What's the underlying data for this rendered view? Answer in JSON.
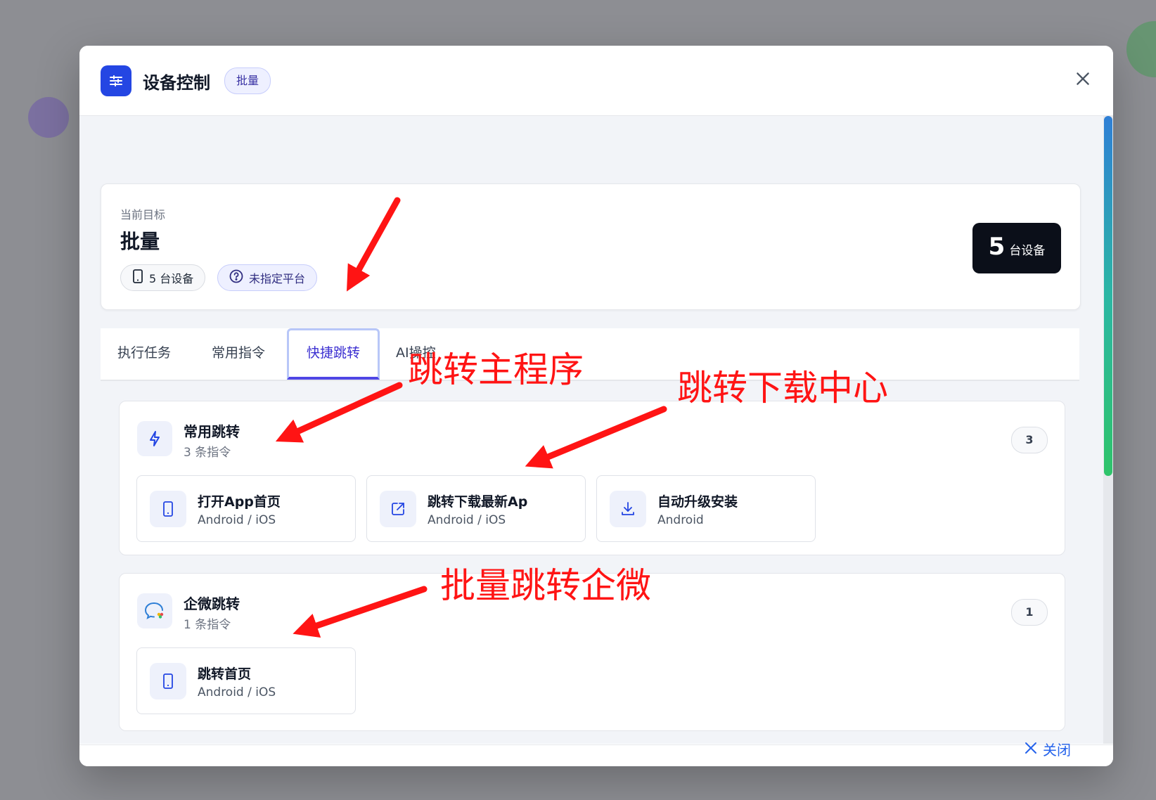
{
  "dialog": {
    "title": "设备控制",
    "badge": "批量",
    "icon": "sliders-icon"
  },
  "target": {
    "caption": "当前目标",
    "name": "批量",
    "devices_chip": "5 台设备",
    "platform_chip": "未指定平台",
    "count_number": "5",
    "count_unit": "台设备"
  },
  "tabs": [
    {
      "label": "执行任务",
      "active": false
    },
    {
      "label": "常用指令",
      "active": false
    },
    {
      "label": "快捷跳转",
      "active": true
    },
    {
      "label": "AI操控",
      "active": false
    }
  ],
  "groups": [
    {
      "title": "常用跳转",
      "subtitle": "3 条指令",
      "count": "3",
      "icon": "lightning-icon",
      "commands": [
        {
          "name": "打开App首页",
          "platforms": "Android / iOS",
          "icon": "phone-icon"
        },
        {
          "name": "跳转下载最新Ap",
          "platforms": "Android / iOS",
          "icon": "external-link-icon"
        },
        {
          "name": "自动升级安装",
          "platforms": "Android",
          "icon": "download-icon"
        }
      ]
    },
    {
      "title": "企微跳转",
      "subtitle": "1 条指令",
      "count": "1",
      "icon": "wecom-icon",
      "commands": [
        {
          "name": "跳转首页",
          "platforms": "Android / iOS",
          "icon": "phone-icon"
        }
      ]
    }
  ],
  "footer": {
    "close_label": "关闭"
  },
  "annotations": {
    "main_app": "跳转主程序",
    "download_center": "跳转下载中心",
    "batch_wecom": "批量跳转企微"
  },
  "colors": {
    "accent": "#4f46e5",
    "primary": "#2446e3",
    "annotation": "#ff1414"
  }
}
